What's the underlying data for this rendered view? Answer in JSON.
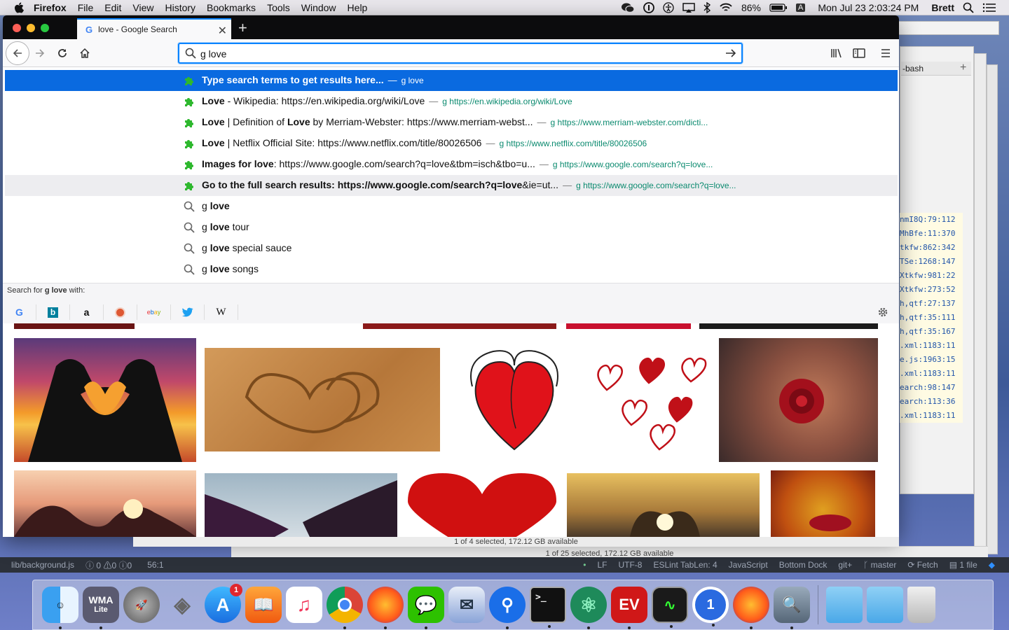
{
  "menubar": {
    "app": "Firefox",
    "items": [
      "File",
      "Edit",
      "View",
      "History",
      "Bookmarks",
      "Tools",
      "Window",
      "Help"
    ],
    "battery": "86%",
    "input_source": "A",
    "clock": "Mon Jul 23  2:03:24 PM",
    "user": "Brett"
  },
  "tab": {
    "title": "love - Google Search"
  },
  "urlbar": {
    "value": "g love"
  },
  "dropdown": {
    "rows": [
      {
        "bold": "",
        "plain": "Type search terms to get results here...",
        "sep": "—",
        "url": "g love"
      },
      {
        "pre": "Love",
        "mid": " - Wikipedia: https://en.wikipedia.org/wiki/",
        "post": "Love",
        "sep": "—",
        "url": "g https://en.wikipedia.org/wiki/Love"
      },
      {
        "pre": "Love",
        "mid": " | Definition of ",
        "b2": "Love",
        "post": " by Merriam-Webster: https://www.merriam-webst...",
        "sep": "—",
        "url": "g https://www.merriam-webster.com/dicti..."
      },
      {
        "pre": "Love",
        "mid": " | Netflix Official Site: https://www.netflix.com/title/80026506",
        "sep": "—",
        "url": "g https://www.netflix.com/title/80026506"
      },
      {
        "pre": "Images for ",
        "b2": "love",
        "post": ": https://www.google.com/search?q=love&tbm=isch&tbo=u...",
        "sep": "—",
        "url": "g https://www.google.com/search?q=love..."
      },
      {
        "pre": "Go to the full search results: https://www.google.com/search?q=",
        "b2": "love",
        "post": "&ie=ut...",
        "sep": "—",
        "url": "g https://www.google.com/search?q=love..."
      }
    ],
    "suggestions": [
      {
        "a": "g ",
        "b": "love",
        "c": ""
      },
      {
        "a": "g ",
        "b": "love",
        "c": " tour"
      },
      {
        "a": "g ",
        "b": "love",
        "c": " special sauce"
      },
      {
        "a": "g ",
        "b": "love",
        "c": " songs"
      }
    ],
    "oneoff_label_pre": "Search for ",
    "oneoff_label_query": "g love",
    "oneoff_label_post": " with:",
    "engines": [
      "google-icon",
      "bing-icon",
      "amazon-icon",
      "duckduckgo-icon",
      "ebay-icon",
      "twitter-icon",
      "wikipedia-icon"
    ]
  },
  "background": {
    "bash_tab": "-bash",
    "code_lines": [
      "nmI8Q:79:112",
      "MhBfe:11:370",
      "tkfw:862:342",
      "TSe:1268:147",
      "Xtkfw:981:22",
      "Xtkfw:273:52",
      "h,qtf:27:137",
      "h,qtf:35:111",
      "h,qtf:35:167",
      ".xml:1183:11",
      "e.js:1963:15",
      ".xml:1183:11",
      "earch:98:147",
      "earch:113:36",
      ".xml:1183:11"
    ],
    "finder_status_1": "1 of 4 selected, 172.12 GB available",
    "finder_status_2": "1 of 25 selected, 172.12 GB available"
  },
  "atom_status": {
    "file": "lib/background.js",
    "errors": "0",
    "warnings": "0",
    "infos": "0",
    "cursor": "56:1",
    "eol": "LF",
    "encoding": "UTF-8",
    "lint": "ESLint TabLen: 4",
    "grammar": "JavaScript",
    "dock": "Bottom Dock",
    "git": "git+",
    "branch": "master",
    "fetch": "Fetch",
    "files": "1 file"
  },
  "dock": {
    "wma_label": "WMA",
    "wma_sub": "Lite",
    "appstore_badge": "1"
  }
}
